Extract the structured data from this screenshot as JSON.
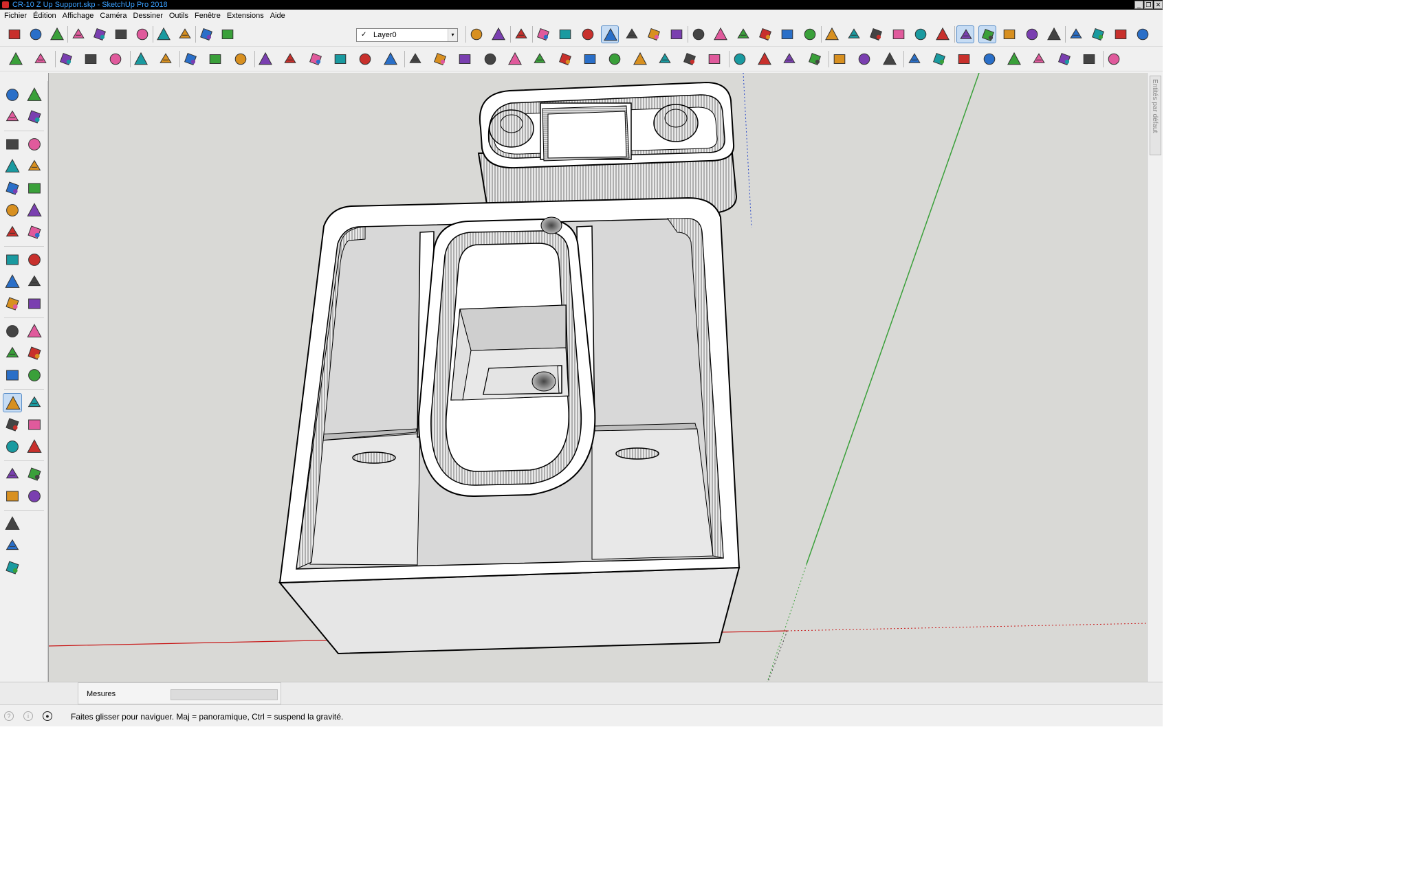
{
  "window": {
    "title": "CR-10 Z Up Support.skp - SketchUp Pro 2018",
    "buttons": [
      "_",
      "❐",
      "✕"
    ]
  },
  "menu": [
    "Fichier",
    "Édition",
    "Affichage",
    "Caméra",
    "Dessiner",
    "Outils",
    "Fenêtre",
    "Extensions",
    "Aide"
  ],
  "layer": {
    "selected": "Layer0",
    "check": "✓",
    "arrow": "▾"
  },
  "colors": {
    "viewport_bg": "#d9d9d6",
    "red_axis": "#c81818",
    "green_axis": "#3aa03a",
    "blue_axis": "#2848c8",
    "face_top": "#ffffff",
    "face_side": "#e6e6e6",
    "edge": "#000000",
    "active_tool": "#c6dcf4"
  },
  "toolbar_top": [
    "new-model-icon",
    "open-icon",
    "save-icon",
    "cut-icon",
    "copy-icon",
    "paste-icon",
    "erase-icon",
    "undo-icon",
    "redo-icon",
    "print-icon",
    "model-info-icon",
    "select-icon",
    "3d-warehouse-icon",
    "share-model-icon",
    "xray-icon",
    "back-edges-icon",
    "wireframe-icon",
    "hidden-line-icon",
    "shaded-icon",
    "shaded-textures-icon",
    "monochrome-icon",
    "iso-icon",
    "top-view-icon",
    "front-view-icon",
    "right-view-icon",
    "back-view-icon",
    "left-view-icon",
    "outer-shell-icon",
    "intersect-icon",
    "union-icon",
    "subtract-icon",
    "trim-icon",
    "split-icon",
    "orbit-icon",
    "walkthrough-icon",
    "pan-icon",
    "section-plane-icon",
    "sandbox-icon",
    "add-location-icon",
    "extension-warehouse-icon",
    "toggle-terrain-icon",
    "axes-icon"
  ],
  "toolbar_second": [
    "paint-bucket-icon",
    "text-icon",
    "dimension-icon",
    "tape-icon",
    "protractor-icon",
    "follow-me-icon",
    "rotate-icon",
    "scale-icon",
    "offset-icon",
    "brick-texture-icon",
    "grid-texture-icon",
    "stamp-icon",
    "drape-icon",
    "add-detail-icon",
    "flip-edge-icon",
    "smoove-icon",
    "cube-icon",
    "prism-icon",
    "wedge-icon",
    "pyramid-icon",
    "cylinder-icon",
    "sphere-icon",
    "cone-icon",
    "dome-icon",
    "torus-icon",
    "helix-icon",
    "geodesic-icon",
    "tube-icon",
    "u-bend-icon",
    "component-icon",
    "group-icon",
    "explode-icon",
    "lock-icon",
    "section-cut-icon",
    "section-display-icon",
    "section-fill-icon",
    "move-red-icon",
    "move-black-icon",
    "move-blue-icon",
    "move-r-icon",
    "move-y-icon",
    "move-n-icon",
    "move-x-icon",
    "move-f-icon",
    "compass-icon"
  ],
  "palette": [
    "select-tool-icon",
    "component-tool-icon",
    "paint-tool-icon",
    "eraser-tool-icon",
    "line-tool-icon",
    "freehand-tool-icon",
    "rectangle-tool-icon",
    "rotated-rect-tool-icon",
    "circle-tool-icon",
    "polygon-tool-icon",
    "arc-tool-icon",
    "pie-tool-icon",
    "2pt-arc-tool-icon",
    "3pt-arc-tool-icon",
    "move-tool-icon",
    "push-pull-tool-icon",
    "rotate-tool-icon",
    "follow-me-tool-icon",
    "scale-tool-icon",
    "offset-tool-icon",
    "tape-tool-icon",
    "text-tool-icon",
    "protractor-tool-icon",
    "3d-text-tool-icon",
    "axes-tool-icon",
    "section-tool-icon",
    "orbit-tool-icon",
    "pan-tool-icon",
    "zoom-tool-icon",
    "zoom-window-tool-icon",
    "zoom-extents-tool-icon",
    "previous-view-tool-icon",
    "position-camera-tool-icon",
    "look-around-tool-icon",
    "walk-tool-icon",
    "crosshair-tool-icon",
    "warehouse-red-icon",
    "warehouse-blue-icon",
    "warehouse-grey-icon"
  ],
  "right_tray": {
    "label": "Entités par défaut"
  },
  "measure": {
    "label": "Mesures",
    "value": ""
  },
  "status": {
    "text": "Faites glisser pour naviguer. Maj = panoramique, Ctrl =  suspend la gravité."
  }
}
